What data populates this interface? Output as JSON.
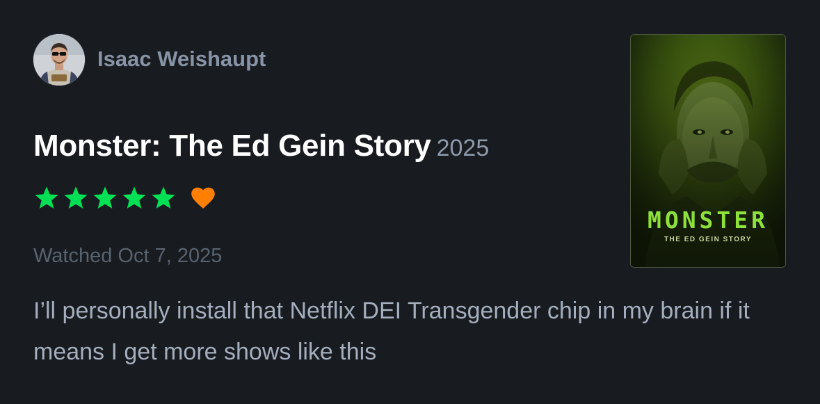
{
  "user": {
    "name": "Isaac Weishaupt"
  },
  "film": {
    "title": "Monster: The Ed Gein Story",
    "year": "2025"
  },
  "rating": {
    "stars": 5,
    "max_stars": 5,
    "liked": true,
    "star_color": "#00e054",
    "heart_color": "#ff8000"
  },
  "watched": "Watched Oct 7, 2025",
  "review": {
    "text": "I’ll personally install that Netflix DEI Transgender chip in my brain if it means I get more shows like this"
  },
  "poster": {
    "title": "MONSTER",
    "subtitle": "THE ED GEIN STORY"
  },
  "icons": {
    "star": "star-icon",
    "heart": "heart-icon",
    "avatar": "user-avatar"
  },
  "colors": {
    "background": "#181b20",
    "username": "#8894a5",
    "year": "#8e9aab",
    "watched": "#59636f",
    "review": "#a4aebd"
  }
}
